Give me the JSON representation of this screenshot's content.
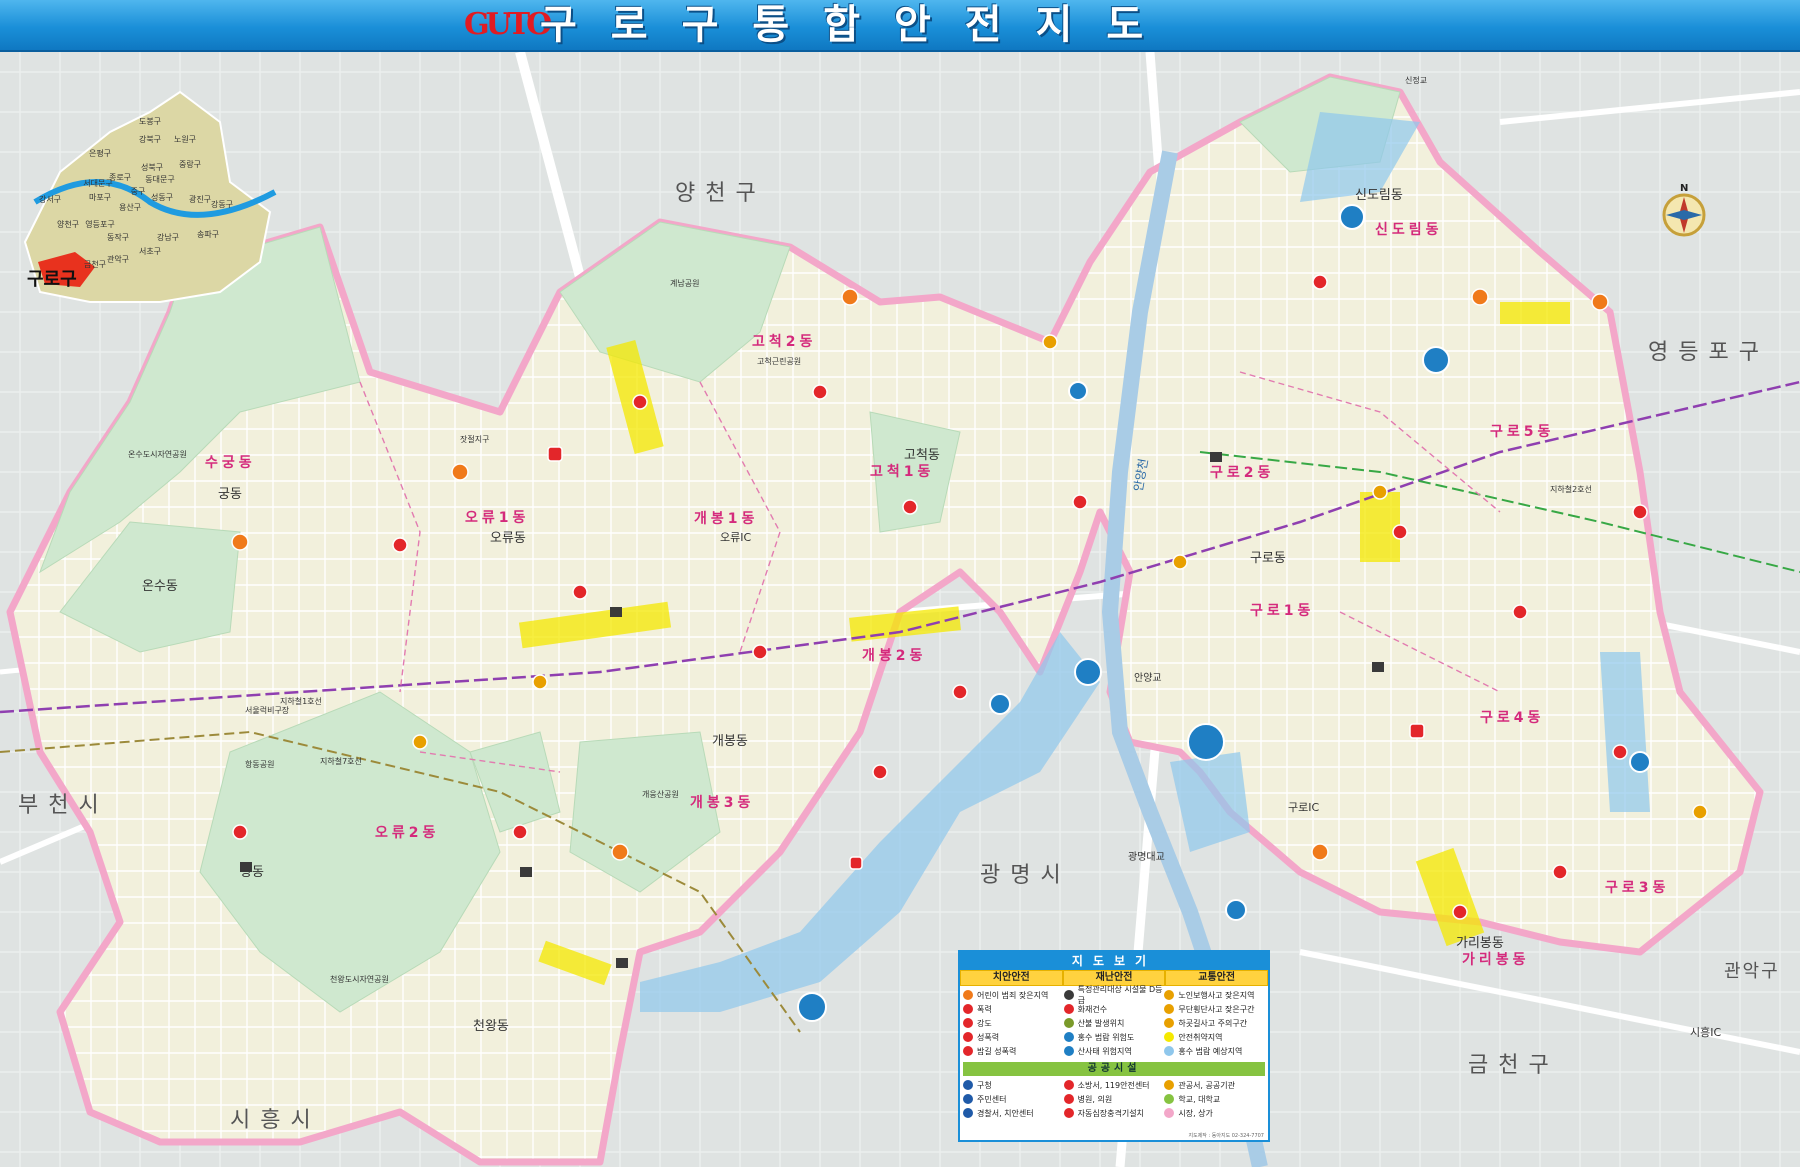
{
  "header": {
    "logo_text": "GUTO",
    "title": "구로구통합안전지도"
  },
  "colors": {
    "header_blue": "#1a8fd8",
    "district_border": "#f3a7c9",
    "residential": "#f2f0dc",
    "park": "#cfe8cf",
    "river": "#a9cce6",
    "flood_zone": "#8fc7ec",
    "safety_zone": "#f5e900",
    "pink_label": "#d42a7c"
  },
  "inset": {
    "seoul_districts": [
      "도봉구",
      "강북구",
      "노원구",
      "은평구",
      "성북구",
      "중랑구",
      "종로구",
      "동대문구",
      "서대문구",
      "마포구",
      "중구",
      "성동구",
      "광진구",
      "강서구",
      "용산구",
      "강동구",
      "양천구",
      "영등포구",
      "동작구",
      "송파구",
      "강남구",
      "금천구",
      "관악구",
      "서초구"
    ],
    "highlight_label": "구로구"
  },
  "regions": {
    "yangcheon": "양천구",
    "yeongdeungpo": "영등포구",
    "bucheon": "부천시",
    "gwangmyeong": "광명시",
    "siheung": "시흥시",
    "geumcheon": "금천구",
    "gwanak": "관악구"
  },
  "dongs": {
    "sugung": "수궁동",
    "gung": "궁동",
    "onsu": "온수동",
    "oryu1": "오류1동",
    "oryu": "오류동",
    "oryu2": "오류2동",
    "hang": "항동",
    "cheonwang": "천왕동",
    "gocheok2": "고척2동",
    "gocheok1": "고척1동",
    "gocheok": "고척동",
    "gaebong1": "개봉1동",
    "gaebong2": "개봉2동",
    "gaebong3": "개봉3동",
    "gaebong": "개봉동",
    "sindorim_plain": "신도림동",
    "sindorim": "신도림동",
    "guro2": "구로2동",
    "guro5": "구로5동",
    "guro1": "구로1동",
    "guro_plain": "구로동",
    "guro4": "구로4동",
    "guro3": "구로3동",
    "garibong_plain": "가리봉동",
    "garibong": "가리봉동"
  },
  "landmarks": {
    "oryu_ic": "오류IC",
    "guro_ic": "구로IC",
    "siheung_ic": "시흥IC",
    "anyang_bridge": "안양교",
    "gwangmyeong_bridge": "광명대교",
    "gaeungsan_park": "개웅산공원",
    "gyenamsan_park": "계남공원",
    "gocheok_park": "고척근린공원",
    "onsu_park": "온수도시자연공원",
    "cheonwang_park": "천왕도시자연공원",
    "hangdong_park": "항동공원",
    "seoul_camp": "서울럭비구장",
    "anyangcheon": "안양천",
    "sindorim_station": "신정교",
    "line1": "지하철1호선",
    "line2": "지하철2호선",
    "line7": "지하철7호선",
    "jangcheol": "잣절지구"
  },
  "legend": {
    "title": "지도보기",
    "heads": [
      "치안안전",
      "재난안전",
      "교통안전"
    ],
    "police": [
      {
        "label": "어린이 범죄 잦은지역",
        "color": "#f07a1a"
      },
      {
        "label": "폭력",
        "color": "#e3262a"
      },
      {
        "label": "강도",
        "color": "#e3262a"
      },
      {
        "label": "성폭력",
        "color": "#e3262a"
      },
      {
        "label": "밤길 성폭력",
        "color": "#e3262a"
      }
    ],
    "disaster": [
      {
        "label": "특정관리대상 시설물 D등급",
        "color": "#3a3a3a"
      },
      {
        "label": "화재건수",
        "color": "#e3262a"
      },
      {
        "label": "산불 발생위치",
        "color": "#7a9a2a"
      },
      {
        "label": "홍수 범람 위험도",
        "color": "#1f7fc4"
      },
      {
        "label": "산사태 위험지역",
        "color": "#1f7fc4"
      }
    ],
    "traffic": [
      {
        "label": "노인보행사고 잦은지역",
        "color": "#e8a000"
      },
      {
        "label": "무단횡단사고 잦은구간",
        "color": "#e8a000"
      },
      {
        "label": "하굣길사고 주의구간",
        "color": "#e8a000"
      },
      {
        "label": "안전취약지역",
        "color": "#f5e900"
      },
      {
        "label": "홍수 범람 예상지역",
        "color": "#8fc7ec"
      }
    ],
    "public_title": "공공시설",
    "public_cols": [
      [
        {
          "label": "구청",
          "color": "#1f5aa8"
        },
        {
          "label": "주민센터",
          "color": "#1f5aa8"
        },
        {
          "label": "경찰서, 치안센터",
          "color": "#1f5aa8"
        }
      ],
      [
        {
          "label": "소방서, 119안전센터",
          "color": "#e3262a"
        },
        {
          "label": "병원, 의원",
          "color": "#e3262a"
        },
        {
          "label": "자동심장충격기설치",
          "color": "#e3262a"
        }
      ],
      [
        {
          "label": "관공서, 공공기관",
          "color": "#e8a000"
        },
        {
          "label": "학교, 대학교",
          "color": "#86c341"
        },
        {
          "label": "시장, 상가",
          "color": "#f3a7c9"
        }
      ]
    ],
    "credit": "지도제작 : 동아지도 02-324-7707"
  },
  "compass": {
    "north_label": "N"
  }
}
